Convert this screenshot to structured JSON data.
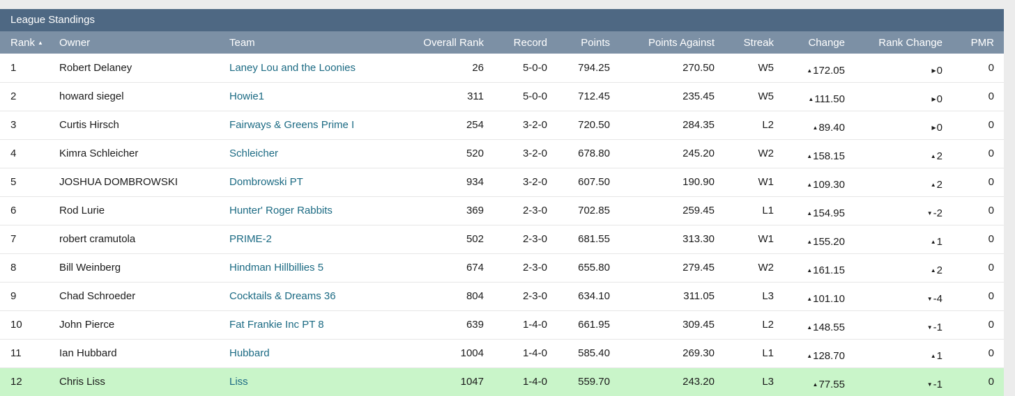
{
  "panel": {
    "title": "League Standings"
  },
  "columns": [
    {
      "label": "Rank",
      "sorted": "asc",
      "sort_icon": "sort-ascending-icon"
    },
    {
      "label": "Owner"
    },
    {
      "label": "Team"
    },
    {
      "label": "Overall Rank"
    },
    {
      "label": "Record"
    },
    {
      "label": "Points"
    },
    {
      "label": "Points Against"
    },
    {
      "label": "Streak"
    },
    {
      "label": "Change"
    },
    {
      "label": "Rank Change"
    },
    {
      "label": "PMR"
    }
  ],
  "rows": [
    {
      "rank": "1",
      "owner": "Robert Delaney",
      "team": "Laney Lou and the Loonies",
      "overall_rank": "26",
      "record": "5-0-0",
      "points": "794.25",
      "points_against": "270.50",
      "streak": "W5",
      "change": "172.05",
      "change_dir": "up",
      "rank_change": "0",
      "rank_change_dir": "flat",
      "pmr": "0"
    },
    {
      "rank": "2",
      "owner": "howard siegel",
      "team": "Howie1",
      "overall_rank": "311",
      "record": "5-0-0",
      "points": "712.45",
      "points_against": "235.45",
      "streak": "W5",
      "change": "111.50",
      "change_dir": "up",
      "rank_change": "0",
      "rank_change_dir": "flat",
      "pmr": "0"
    },
    {
      "rank": "3",
      "owner": "Curtis Hirsch",
      "team": "Fairways & Greens Prime I",
      "overall_rank": "254",
      "record": "3-2-0",
      "points": "720.50",
      "points_against": "284.35",
      "streak": "L2",
      "change": "89.40",
      "change_dir": "up",
      "rank_change": "0",
      "rank_change_dir": "flat",
      "pmr": "0"
    },
    {
      "rank": "4",
      "owner": "Kimra Schleicher",
      "team": "Schleicher",
      "overall_rank": "520",
      "record": "3-2-0",
      "points": "678.80",
      "points_against": "245.20",
      "streak": "W2",
      "change": "158.15",
      "change_dir": "up",
      "rank_change": "2",
      "rank_change_dir": "up",
      "pmr": "0"
    },
    {
      "rank": "5",
      "owner": "JOSHUA DOMBROWSKI",
      "team": "Dombrowski PT",
      "overall_rank": "934",
      "record": "3-2-0",
      "points": "607.50",
      "points_against": "190.90",
      "streak": "W1",
      "change": "109.30",
      "change_dir": "up",
      "rank_change": "2",
      "rank_change_dir": "up",
      "pmr": "0"
    },
    {
      "rank": "6",
      "owner": "Rod Lurie",
      "team": "Hunter' Roger Rabbits",
      "overall_rank": "369",
      "record": "2-3-0",
      "points": "702.85",
      "points_against": "259.45",
      "streak": "L1",
      "change": "154.95",
      "change_dir": "up",
      "rank_change": "-2",
      "rank_change_dir": "down",
      "pmr": "0"
    },
    {
      "rank": "7",
      "owner": "robert cramutola",
      "team": "PRIME-2",
      "overall_rank": "502",
      "record": "2-3-0",
      "points": "681.55",
      "points_against": "313.30",
      "streak": "W1",
      "change": "155.20",
      "change_dir": "up",
      "rank_change": "1",
      "rank_change_dir": "up",
      "pmr": "0"
    },
    {
      "rank": "8",
      "owner": "Bill Weinberg",
      "team": "Hindman Hillbillies 5",
      "overall_rank": "674",
      "record": "2-3-0",
      "points": "655.80",
      "points_against": "279.45",
      "streak": "W2",
      "change": "161.15",
      "change_dir": "up",
      "rank_change": "2",
      "rank_change_dir": "up",
      "pmr": "0"
    },
    {
      "rank": "9",
      "owner": "Chad Schroeder",
      "team": "Cocktails & Dreams 36",
      "overall_rank": "804",
      "record": "2-3-0",
      "points": "634.10",
      "points_against": "311.05",
      "streak": "L3",
      "change": "101.10",
      "change_dir": "up",
      "rank_change": "-4",
      "rank_change_dir": "down",
      "pmr": "0"
    },
    {
      "rank": "10",
      "owner": "John Pierce",
      "team": "Fat Frankie Inc PT 8",
      "overall_rank": "639",
      "record": "1-4-0",
      "points": "661.95",
      "points_against": "309.45",
      "streak": "L2",
      "change": "148.55",
      "change_dir": "up",
      "rank_change": "-1",
      "rank_change_dir": "down",
      "pmr": "0"
    },
    {
      "rank": "11",
      "owner": "Ian Hubbard",
      "team": "Hubbard",
      "overall_rank": "1004",
      "record": "1-4-0",
      "points": "585.40",
      "points_against": "269.30",
      "streak": "L1",
      "change": "128.70",
      "change_dir": "up",
      "rank_change": "1",
      "rank_change_dir": "up",
      "pmr": "0"
    },
    {
      "rank": "12",
      "owner": "Chris Liss",
      "team": "Liss",
      "overall_rank": "1047",
      "record": "1-4-0",
      "points": "559.70",
      "points_against": "243.20",
      "streak": "L3",
      "change": "77.55",
      "change_dir": "up",
      "rank_change": "-1",
      "rank_change_dir": "down",
      "pmr": "0",
      "highlighted": true
    }
  ],
  "colors": {
    "title_bar": "#4e6883",
    "header_row": "#7c90a5",
    "team_link": "#1b6a83",
    "highlight_row": "#c9f5c9",
    "page_bg": "#ececec"
  }
}
